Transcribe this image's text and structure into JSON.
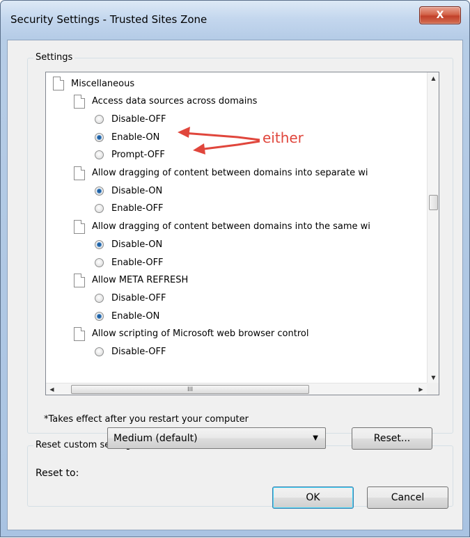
{
  "window": {
    "title": "Security Settings - Trusted Sites Zone",
    "close_label": "X"
  },
  "settings_group": {
    "label": "Settings"
  },
  "settings_list": [
    {
      "kind": "header",
      "text": "Miscellaneous"
    },
    {
      "kind": "category",
      "text": "Access data sources across domains"
    },
    {
      "kind": "option",
      "text": "Disable-OFF",
      "checked": false
    },
    {
      "kind": "option",
      "text": "Enable-ON",
      "checked": true
    },
    {
      "kind": "option",
      "text": "Prompt-OFF",
      "checked": false
    },
    {
      "kind": "category",
      "text": "Allow dragging of content between domains into separate wi"
    },
    {
      "kind": "option",
      "text": "Disable-ON",
      "checked": true
    },
    {
      "kind": "option",
      "text": "Enable-OFF",
      "checked": false
    },
    {
      "kind": "category",
      "text": "Allow dragging of content between domains into the same wi"
    },
    {
      "kind": "option",
      "text": "Disable-ON",
      "checked": true
    },
    {
      "kind": "option",
      "text": "Enable-OFF",
      "checked": false
    },
    {
      "kind": "category",
      "text": "Allow META REFRESH"
    },
    {
      "kind": "option",
      "text": "Disable-OFF",
      "checked": false
    },
    {
      "kind": "option",
      "text": "Enable-ON",
      "checked": true
    },
    {
      "kind": "category",
      "text": "Allow scripting of Microsoft web browser control"
    },
    {
      "kind": "option",
      "text": "Disable-OFF",
      "checked": false
    }
  ],
  "scrollbar": {
    "h_grip": "III"
  },
  "note": "*Takes effect after you restart your computer",
  "reset_group": {
    "label": "Reset custom settings",
    "reset_to_label": "Reset to:",
    "selected_level": "Medium (default)",
    "reset_button": "Reset..."
  },
  "buttons": {
    "ok": "OK",
    "cancel": "Cancel"
  },
  "annotation": {
    "text": "either",
    "color": "#e0463c"
  }
}
